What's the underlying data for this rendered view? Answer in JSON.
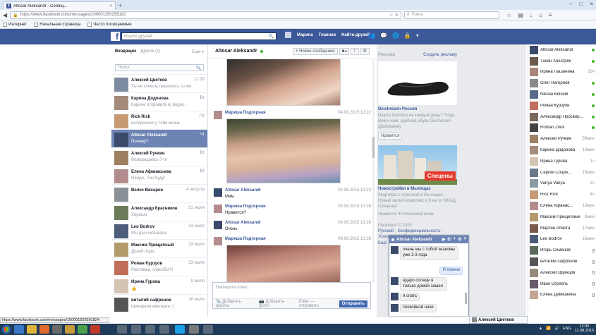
{
  "browser": {
    "tab_title": "Altosar Aleksandr - Сообщ...",
    "url": "https://www.facebook.com/messages/100001150259182",
    "search_placeholder": "Поиск",
    "bookmarks": [
      "Интернет",
      "Начальная страница",
      "Часто посещаемые"
    ],
    "status_url": "https://www.facebook.com/messages/100001502591824"
  },
  "fb_header": {
    "logo": "f",
    "search_placeholder": "Ищите друзей",
    "nav": [
      "Марина",
      "Главная",
      "Найти друзей"
    ]
  },
  "inbox": {
    "tab_inbox": "Входящие",
    "tab_other": "Другое (1)",
    "more": "Еще ▾",
    "search_placeholder": "Поиск",
    "threads": [
      {
        "name": "Алексей Цветков",
        "preview": "Ты не хочешь переехать со мной во...",
        "time": "12:30",
        "color": "#7d8aa0"
      },
      {
        "name": "Карина Додонова",
        "preview": "Карина отправил(-а) видео.",
        "time": "Вт",
        "color": "#a58b79"
      },
      {
        "name": "Rick Rick",
        "preview": "интересное у тебя жизнь",
        "time": "Пт",
        "color": "#c59a74"
      },
      {
        "name": "Altosar Aleksandr",
        "preview": "Почему?",
        "time": "Чт",
        "color": "#3a4a6a"
      },
      {
        "name": "Алексей Ручкин",
        "preview": "Возвращаюсь 7-го",
        "time": "Вт",
        "color": "#9d7f62"
      },
      {
        "name": "Елена Афанасьева",
        "preview": "Найди, Тою буду!",
        "time": "Вт",
        "color": "#b38d8d"
      },
      {
        "name": "Велес Вихарев",
        "preview": "",
        "time": "4 августа",
        "color": "#8a9298"
      },
      {
        "name": "Александр Красников",
        "preview": "Хорошо",
        "time": "31 июля",
        "color": "#6c7b59"
      },
      {
        "name": "Leo Bodrov",
        "preview": "Мы рассчитывали",
        "time": "24 июля",
        "color": "#4d5d7a"
      },
      {
        "name": "Максим Прищепный",
        "preview": "Доной порю",
        "time": "23 июля",
        "color": "#b39a6a"
      },
      {
        "name": "Роман Курзуов",
        "preview": "Рекламка, спасибо!!!!",
        "time": "23 июля",
        "color": "#c0705a"
      },
      {
        "name": "Ирина Гурова",
        "preview": "👍",
        "time": "9 июля",
        "color": "#d4c4b4"
      },
      {
        "name": "виталий сафронов",
        "preview": "Шикарная аватарка :)",
        "time": "18 июля",
        "color": "#555"
      }
    ]
  },
  "conversation": {
    "name": "Altosar Aleksandr",
    "new_message": "+ Новое сообщение",
    "messages": [
      {
        "sender": "Мариша Подгорная",
        "time": "04.08.2015 13:22",
        "text": "",
        "pic": "#b38d8d"
      },
      {
        "sender": "Altosar Aleksandr",
        "time": "04.08.2015 13:23",
        "text": "Мим",
        "pic": "#3a4a6a"
      },
      {
        "sender": "Мариша Подгорная",
        "time": "04.08.2015 13:26",
        "text": "Нравится?",
        "pic": "#b38d8d"
      },
      {
        "sender": "Altosar Aleksandr",
        "time": "04.08.2015 13:26",
        "text": "Очень",
        "pic": "#3a4a6a"
      },
      {
        "sender": "Мариша Подгорная",
        "time": "04.08.2015 13:28",
        "text": "",
        "pic": "#b38d8d"
      }
    ],
    "composer_placeholder": "Напишите ответ...",
    "add_files": "Добавить файлы",
    "add_photos": "Добавить фото",
    "enter_send": "Enter — отправить",
    "send": "Отправить"
  },
  "ads": {
    "header": "Реклама",
    "create": "Создать рекламу",
    "ad1_title": "Deichmann Россия",
    "ad1_text": "Ищете балетки на каждый день? Тогда Вам к нам: удобная обувь Deichmann (Дайхманн).",
    "like": "Нравится",
    "ad2_badge": "Спецены",
    "ad2_title": "Новостройки в Мытищах",
    "ad2_text": "Квартиры с отделкой в Мытищах. Новый жилой комплекс в 3 км от МКАД. Спецены!",
    "ad2_likes": "Нравится 40 пользователям",
    "footer_copy": "Facebook © 2015",
    "footer_links": "Русский · Конфиденциальность · Условия · Файлы cookie · Реклама",
    "footer_more": "Ещё"
  },
  "chat": {
    "title": "Altosar Aleksandr",
    "messages": [
      {
        "me": false,
        "text": "очень мы с тобой знакомы уже 2-3 года"
      },
      {
        "me": true,
        "text": "Я помню"
      },
      {
        "me": false,
        "text": "ядаро солнце я только домой зашел"
      },
      {
        "me": false,
        "text": "я спать"
      },
      {
        "me": false,
        "text": "спокойной ночи"
      }
    ],
    "minimized_name": "Алексей Цветков"
  },
  "sidebar": [
    {
      "name": "Altosar Aleksandr",
      "status": "dot",
      "color": "#3a4a6a"
    },
    {
      "name": "Тахан Хачатрян",
      "status": "dot",
      "color": "#6b5a4a"
    },
    {
      "name": "Ирина Пашинина",
      "status": "18ч",
      "color": "#a8857a"
    },
    {
      "name": "Олег Нагорнов",
      "status": "dot",
      "color": "#8a8a8a"
    },
    {
      "name": "Nikolai Belvedi",
      "status": "dot",
      "color": "#556b88"
    },
    {
      "name": "Роман Курзуов",
      "status": "dot",
      "color": "#c0705a"
    },
    {
      "name": "Александр Просвир...",
      "status": "dot",
      "color": "#7a6a5a"
    },
    {
      "name": "Roman Zhuk",
      "status": "dot",
      "color": "#444"
    },
    {
      "name": "Алексей Ручкин",
      "status": "59мин",
      "color": "#9d7f62"
    },
    {
      "name": "Карина Додонова",
      "status": "10мин",
      "color": "#a58b79"
    },
    {
      "name": "Ирина Гурова",
      "status": "1ч",
      "color": "#d4c4b4"
    },
    {
      "name": "Сергей Социе...",
      "status": "15мин",
      "color": "#6a7a8a"
    },
    {
      "name": "Vanya Vanya",
      "status": "2ч",
      "color": "#8a9aa0"
    },
    {
      "name": "Rick Rick",
      "status": "4ч",
      "color": "#c59a74"
    },
    {
      "name": "Елена Афанас...",
      "status": "13мин",
      "color": "#b38d8d"
    },
    {
      "name": "Максим Прищепный",
      "status": "8мин",
      "color": "#b39a6a"
    },
    {
      "name": "Мартин Атмога",
      "status": "17мин",
      "color": "#7a5a4a"
    },
    {
      "name": "Leo Bodrov",
      "status": "16мин",
      "color": "#4d5d7a"
    },
    {
      "name": "Игорь Семенов",
      "status": "mob",
      "color": "#5a6a5a"
    },
    {
      "name": "виталий сафронов",
      "status": "mob",
      "color": "#555"
    },
    {
      "name": "Алексей Одинцов",
      "status": "mob",
      "color": "#9a8a7a"
    },
    {
      "name": "Иван Огребль",
      "status": "mob",
      "color": "#6a5a6a"
    },
    {
      "name": "Елена Дивяшкина",
      "status": "mob",
      "color": "#c4a494"
    }
  ],
  "taskbar": {
    "lang": "ENG",
    "time": "12:30",
    "date": "11.08.2015"
  }
}
